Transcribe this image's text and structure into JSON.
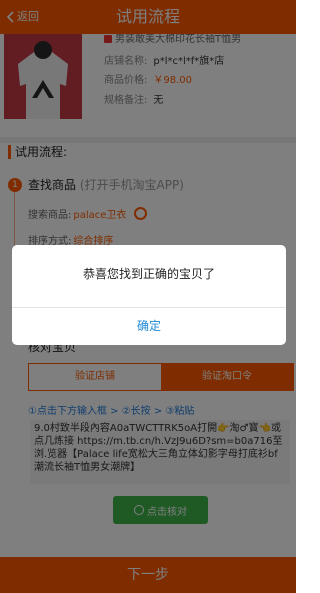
{
  "header": {
    "back_label": "返回",
    "title": "试用流程"
  },
  "product": {
    "name": "男装敢美大棉印花长袖T恤男",
    "rows": [
      {
        "label": "店铺名称:",
        "value": "p*l*c*l*f*旗*店"
      },
      {
        "label": "商品价格:",
        "value": "￥98.00"
      },
      {
        "label": "规格备注:",
        "value": "无"
      }
    ]
  },
  "flow": {
    "section_title": "试用流程:",
    "step1": {
      "num": "1",
      "title": "查找商品",
      "subtitle": "(打开手机淘宝APP)",
      "search_label": "搜索商品:",
      "search_value": "palace卫衣",
      "sort_label": "排序方式:",
      "sort_value": "综合排序"
    },
    "step2": {
      "title": "核对宝贝"
    },
    "tabs": [
      "验证店铺",
      "验证淘口令"
    ],
    "hint": "①点击下方输入框 > ②长按 > ③粘贴",
    "copy_text": "9.0村致半段內容A0aTWCTTRK5oA打開👉淘♂寳👈或点几炼接 https://m.tb.cn/h.VzJ9u6D?sm=b0a716至浏.览器【Palace life宽松大三角立体幻影字母打底衫bf潮流长袖T恤男女潮牌】",
    "check_button": "点击核对"
  },
  "footer": {
    "next_label": "下一步"
  },
  "dialog": {
    "message": "恭喜您找到正确的宝贝了",
    "ok_label": "确定"
  }
}
